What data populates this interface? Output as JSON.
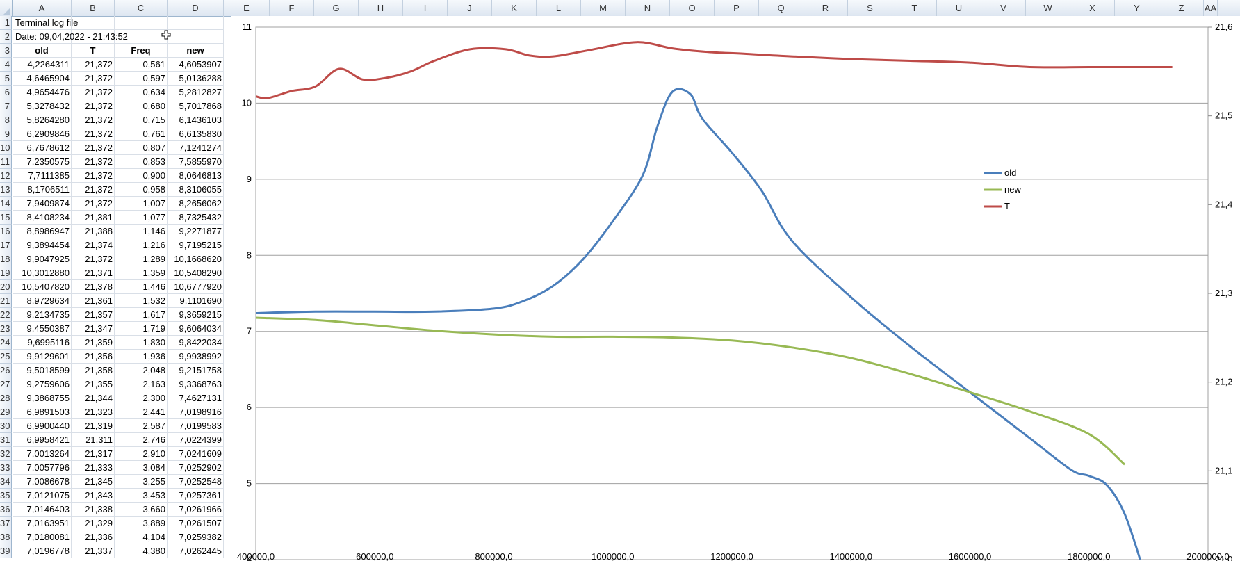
{
  "spreadsheet": {
    "columns": [
      "A",
      "B",
      "C",
      "D",
      "E",
      "F",
      "G",
      "H",
      "I",
      "J",
      "K",
      "L",
      "M",
      "N",
      "O",
      "P",
      "Q",
      "R",
      "S",
      "T",
      "U",
      "V",
      "W",
      "X",
      "Y",
      "Z",
      "AA"
    ],
    "title": "Terminal log file",
    "date": "Date: 09,04,2022 - 21:43:52",
    "headers": [
      "old",
      "T",
      "Freq",
      "new"
    ],
    "rows": [
      [
        "4,2264311",
        "21,372",
        "0,561",
        "4,6053907"
      ],
      [
        "4,6465904",
        "21,372",
        "0,597",
        "5,0136288"
      ],
      [
        "4,9654476",
        "21,372",
        "0,634",
        "5,2812827"
      ],
      [
        "5,3278432",
        "21,372",
        "0,680",
        "5,7017868"
      ],
      [
        "5,8264280",
        "21,372",
        "0,715",
        "6,1436103"
      ],
      [
        "6,2909846",
        "21,372",
        "0,761",
        "6,6135830"
      ],
      [
        "6,7678612",
        "21,372",
        "0,807",
        "7,1241274"
      ],
      [
        "7,2350575",
        "21,372",
        "0,853",
        "7,5855970"
      ],
      [
        "7,7111385",
        "21,372",
        "0,900",
        "8,0646813"
      ],
      [
        "8,1706511",
        "21,372",
        "0,958",
        "8,3106055"
      ],
      [
        "7,9409874",
        "21,372",
        "1,007",
        "8,2656062"
      ],
      [
        "8,4108234",
        "21,381",
        "1,077",
        "8,7325432"
      ],
      [
        "8,8986947",
        "21,388",
        "1,146",
        "9,2271877"
      ],
      [
        "9,3894454",
        "21,374",
        "1,216",
        "9,7195215"
      ],
      [
        "9,9047925",
        "21,372",
        "1,289",
        "10,1668620"
      ],
      [
        "10,3012880",
        "21,371",
        "1,359",
        "10,5408290"
      ],
      [
        "10,5407820",
        "21,378",
        "1,446",
        "10,6777920"
      ],
      [
        "8,9729634",
        "21,361",
        "1,532",
        "9,1101690"
      ],
      [
        "9,2134735",
        "21,357",
        "1,617",
        "9,3659215"
      ],
      [
        "9,4550387",
        "21,347",
        "1,719",
        "9,6064034"
      ],
      [
        "9,6995116",
        "21,359",
        "1,830",
        "9,8422034"
      ],
      [
        "9,9129601",
        "21,356",
        "1,936",
        "9,9938992"
      ],
      [
        "9,5018599",
        "21,358",
        "2,048",
        "9,2151758"
      ],
      [
        "9,2759606",
        "21,355",
        "2,163",
        "9,3368763"
      ],
      [
        "9,3868755",
        "21,344",
        "2,300",
        "7,4627131"
      ],
      [
        "6,9891503",
        "21,323",
        "2,441",
        "7,0198916"
      ],
      [
        "6,9900440",
        "21,319",
        "2,587",
        "7,0199583"
      ],
      [
        "6,9958421",
        "21,311",
        "2,746",
        "7,0224399"
      ],
      [
        "7,0013264",
        "21,317",
        "2,910",
        "7,0241609"
      ],
      [
        "7,0057796",
        "21,333",
        "3,084",
        "7,0252902"
      ],
      [
        "7,0086678",
        "21,345",
        "3,255",
        "7,0252548"
      ],
      [
        "7,0121075",
        "21,343",
        "3,453",
        "7,0257361"
      ],
      [
        "7,0146403",
        "21,338",
        "3,660",
        "7,0261966"
      ],
      [
        "7,0163951",
        "21,329",
        "3,889",
        "7,0261507"
      ],
      [
        "7,0180081",
        "21,336",
        "4,104",
        "7,0259382"
      ],
      [
        "7,0196778",
        "21,337",
        "4,380",
        "7,0262445"
      ]
    ]
  },
  "chart_data": {
    "type": "line",
    "title": "",
    "xlabel": "",
    "ylabel": "",
    "xlim": [
      400000,
      2000000
    ],
    "ylim": [
      4,
      11
    ],
    "y2lim": [
      21.0,
      21.6
    ],
    "x_ticks": [
      "400000,0",
      "600000,0",
      "800000,0",
      "1000000,0",
      "1200000,0",
      "1400000,0",
      "1600000,0",
      "1800000,0",
      "2000000,0"
    ],
    "y_ticks": [
      "4",
      "5",
      "6",
      "7",
      "8",
      "9",
      "10",
      "11"
    ],
    "y2_ticks": [
      "21,0",
      "21,1",
      "21,2",
      "21,3",
      "21,4",
      "21,5",
      "21,6"
    ],
    "grid": "horizontal",
    "legend_position": "right",
    "series": [
      {
        "name": "old",
        "color": "#4a7ebb",
        "axis": "left",
        "x": [
          400000,
          500000,
          600000,
          700000,
          800000,
          850000,
          900000,
          950000,
          1000000,
          1050000,
          1075000,
          1100000,
          1130000,
          1150000,
          1200000,
          1250000,
          1300000,
          1400000,
          1500000,
          1600000,
          1700000,
          1770000,
          1800000,
          1830000,
          1860000,
          1890000
        ],
        "y": [
          7.24,
          7.26,
          7.26,
          7.26,
          7.3,
          7.4,
          7.6,
          7.95,
          8.45,
          9.05,
          9.7,
          10.15,
          10.12,
          9.8,
          9.35,
          8.85,
          8.2,
          7.45,
          6.8,
          6.2,
          5.6,
          5.18,
          5.1,
          4.98,
          4.6,
          3.9
        ]
      },
      {
        "name": "new",
        "color": "#98b954",
        "axis": "left",
        "x": [
          400000,
          500000,
          600000,
          700000,
          800000,
          900000,
          1000000,
          1100000,
          1200000,
          1300000,
          1400000,
          1500000,
          1600000,
          1700000,
          1800000,
          1860000
        ],
        "y": [
          7.18,
          7.15,
          7.08,
          7.01,
          6.96,
          6.93,
          6.93,
          6.92,
          6.88,
          6.79,
          6.65,
          6.44,
          6.2,
          5.95,
          5.65,
          5.25
        ]
      },
      {
        "name": "T",
        "color": "#be4b48",
        "axis": "right",
        "x": [
          400000,
          420000,
          460000,
          500000,
          540000,
          580000,
          620000,
          660000,
          700000,
          760000,
          820000,
          860000,
          900000,
          960000,
          1040000,
          1100000,
          1160000,
          1220000,
          1300000,
          1400000,
          1500000,
          1600000,
          1700000,
          1800000,
          1900000,
          1940000
        ],
        "y": [
          21.522,
          21.52,
          21.528,
          21.533,
          21.553,
          21.541,
          21.543,
          21.55,
          21.562,
          21.575,
          21.575,
          21.568,
          21.567,
          21.574,
          21.583,
          21.576,
          21.572,
          21.57,
          21.567,
          21.564,
          21.562,
          21.56,
          21.555,
          21.555,
          21.555,
          21.555
        ]
      }
    ]
  }
}
